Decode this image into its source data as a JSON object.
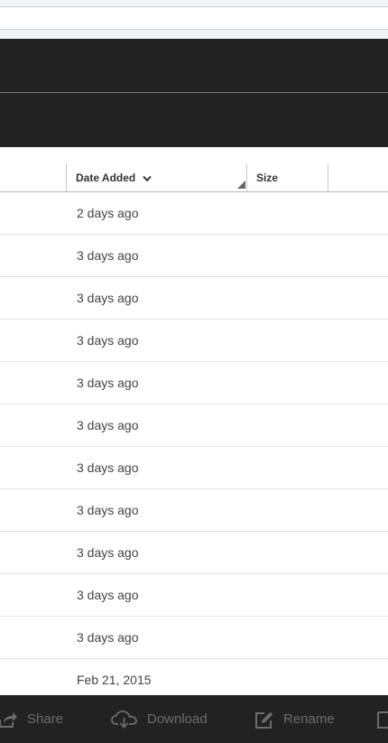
{
  "table": {
    "columns": {
      "date_added": "Date Added",
      "size": "Size"
    },
    "sort": {
      "column": "Date Added",
      "direction": "descending"
    },
    "rows": [
      {
        "date_added": "2 days ago",
        "size": ""
      },
      {
        "date_added": "3 days ago",
        "size": ""
      },
      {
        "date_added": "3 days ago",
        "size": ""
      },
      {
        "date_added": "3 days ago",
        "size": ""
      },
      {
        "date_added": "3 days ago",
        "size": ""
      },
      {
        "date_added": "3 days ago",
        "size": ""
      },
      {
        "date_added": "3 days ago",
        "size": ""
      },
      {
        "date_added": "3 days ago",
        "size": ""
      },
      {
        "date_added": "3 days ago",
        "size": ""
      },
      {
        "date_added": "3 days ago",
        "size": ""
      },
      {
        "date_added": "3 days ago",
        "size": ""
      },
      {
        "date_added": "Feb 21, 2015",
        "size": ""
      }
    ]
  },
  "actions": {
    "share": "Share",
    "download": "Download",
    "rename": "Rename"
  },
  "icons": {
    "share": "share-icon",
    "download": "cloud-download-icon",
    "rename": "edit-icon",
    "sort": "chevron-down-icon"
  },
  "colors": {
    "header_bg": "#222222",
    "action_text": "#6c6c6c",
    "row_border": "#e4e4e4"
  }
}
